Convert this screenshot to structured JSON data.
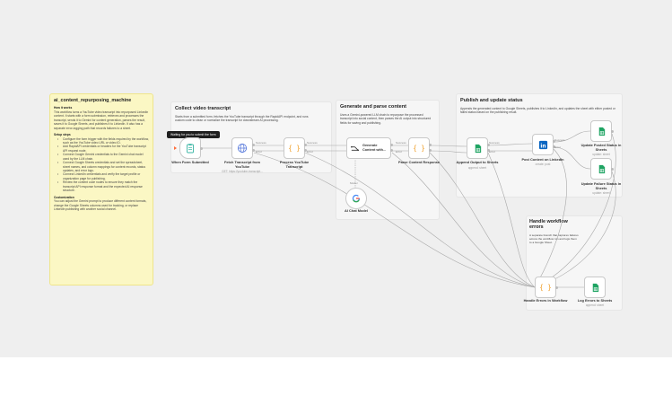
{
  "sticky_main": {
    "title": "ai_content_repurposing_machine",
    "how_heading": "How it works",
    "how_text": "This workflow turns a YouTube video transcript into repurposed LinkedIn content. It starts with a form submission, retrieves and processes the transcript, sends it to Gemini for content generation, parses the result, saves it to Google Sheets, and publishes it to LinkedIn. It also has a separate error-logging path that records failures to a sheet.",
    "setup_heading": "Setup steps",
    "setup_steps": [
      "Configure the form trigger with the fields required by the workflow, such as the YouTube video URL or video ID.",
      "Add RapidAPI credentials or headers for the YouTube transcript API request node.",
      "Connect Google Gemini credentials to the Gemini chat model used by the LLM chain.",
      "Connect Google Sheets credentials and set the spreadsheet, sheet names, and column mappings for content records, status updates, and error logs.",
      "Connect LinkedIn credentials and verify the target profile or organization page for publishing.",
      "Review the content code nodes to ensure they match the transcript API response format and the expected AI response structure."
    ],
    "custom_heading": "Customization",
    "custom_text": "You can adjust the Gemini prompt to produce different content formats, change the Google Sheets columns used for tracking, or replace LinkedIn publishing with another social channel."
  },
  "sticky_collect": {
    "title": "Collect video transcript",
    "text": "Starts from a submitted form, fetches the YouTube transcript through the RapidAPI endpoint, and runs custom code to clean or normalize the transcript for downstream AI processing."
  },
  "sticky_generate": {
    "title": "Generate and parse content",
    "text": "Uses a Gemini-powered LLM chain to repurpose the processed transcript into social content, then parses the AI output into structured fields for saving and publishing."
  },
  "sticky_publish": {
    "title": "Publish and update status",
    "text": "Appends the generated content to Google Sheets, publishes it to LinkedIn, and updates the sheet with either posted or failed status based on the publishing result."
  },
  "sticky_errors": {
    "title": "Handle workflow errors",
    "text": "A separate branch that captures failures across the workflow run and logs them to a Google Sheet."
  },
  "tooltip": "Waiting for you to submit the form",
  "nodes": {
    "form": {
      "label": "When Form Submitted"
    },
    "fetch": {
      "label": "Fetch Transcript from YouTube",
      "sub": "GET: https://youtube-transcript..."
    },
    "process": {
      "label": "Process YouTube Transcript"
    },
    "chain": {
      "title": "Generate",
      "subtitle": "Content with..."
    },
    "parse": {
      "label": "Parse Content Response"
    },
    "model": {
      "label": "AI Chat Model"
    },
    "append": {
      "label": "Append Output to Sheets",
      "sub": "append: sheet"
    },
    "linkedin": {
      "label": "Post Content on LinkedIn",
      "sub": "create: post"
    },
    "posted": {
      "label": "Update Posted Status in Sheets",
      "sub": "update: sheet"
    },
    "failure": {
      "label": "Update Failure Status in Sheets",
      "sub": "update: sheet"
    },
    "errors": {
      "label": "Handle Errors in Workflow"
    },
    "log": {
      "label": "Log Errors to Sheets",
      "sub": "append: sheet"
    }
  },
  "edges": {
    "success": "Success",
    "error": "Error",
    "model": "Model",
    "success_2": "Success",
    "error_2": "Error",
    "success_3": "Success",
    "error_3": "Error",
    "success_4": "Success",
    "error_4": "Error",
    "success_5": "Success",
    "error_5": "Error"
  },
  "colors": {
    "canvas": "#efefef",
    "sticky_yellow": "#fbf7c4",
    "edge": "#a8a8a8",
    "sheets_green": "#1fa463",
    "linkedin_blue": "#0a66c2",
    "code_orange": "#f0a02c",
    "http_blue": "#4a6fd8",
    "form_teal": "#39b5a4",
    "trigger_orange": "#ff6d3a"
  },
  "icons": {
    "form": "clipboard-icon",
    "fetch": "globe-icon",
    "code": "braces-icon",
    "chain": "link-chain-icon",
    "model": "gemini-g-icon",
    "sheets": "sheets-icon",
    "linkedin": "linkedin-icon"
  }
}
